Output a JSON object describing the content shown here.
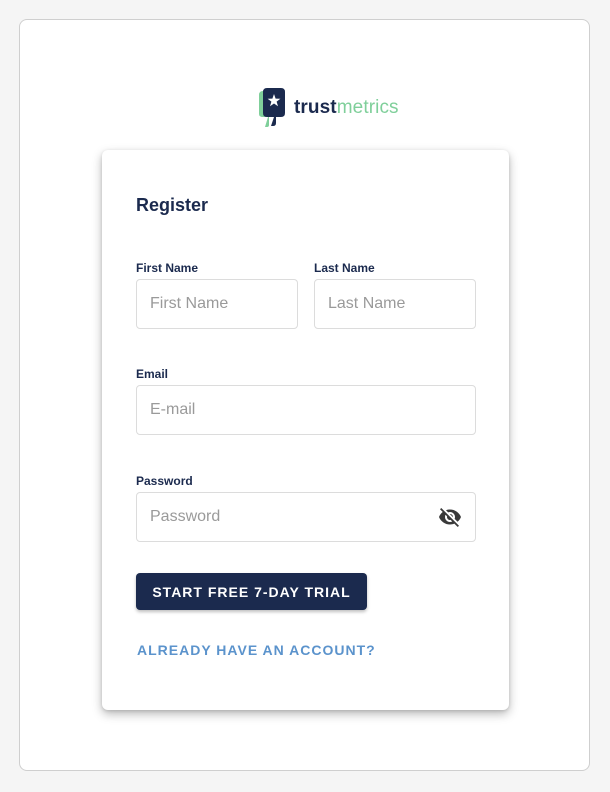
{
  "brand": {
    "name_bold": "trust",
    "name_light": "metrics",
    "dark_color": "#1b2a4e",
    "accent_color": "#7fcf9a",
    "logo_icon": "thumbs-down-star-icon"
  },
  "form": {
    "title": "Register",
    "first_name": {
      "label": "First Name",
      "placeholder": "First Name"
    },
    "last_name": {
      "label": "Last Name",
      "placeholder": "Last Name"
    },
    "email": {
      "label": "Email",
      "placeholder": "E-mail"
    },
    "password": {
      "label": "Password",
      "placeholder": "Password",
      "toggle_icon": "eye-off-icon"
    },
    "submit_label": "START FREE 7-DAY TRIAL",
    "login_link": "ALREADY HAVE AN ACCOUNT?",
    "link_color": "#5b93cc"
  }
}
